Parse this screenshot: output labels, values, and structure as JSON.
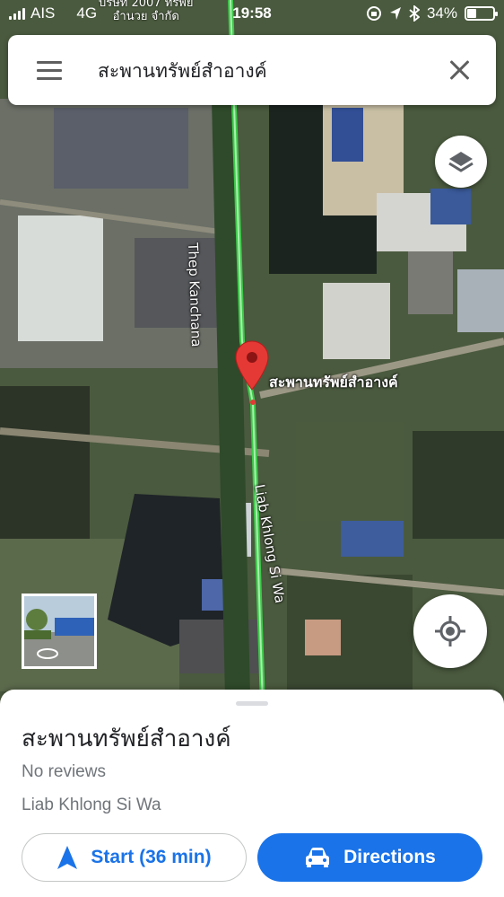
{
  "status_bar": {
    "carrier": "AIS",
    "network": "4G",
    "time": "19:58",
    "battery": "34%",
    "battery_level": 0.34,
    "icons": [
      "signal-icon",
      "rotation-lock-icon",
      "location-arrow-icon",
      "bluetooth-icon",
      "battery-icon"
    ]
  },
  "search": {
    "query": "สะพานทรัพย์สำอางค์",
    "menu_icon": "hamburger-menu-icon",
    "close_icon": "close-icon"
  },
  "map": {
    "road_label_north": "Thep Kanchana",
    "road_label_south": "Liab Khlong Si Wa",
    "pin_label": "สะพานทรัพย์สำอางค์",
    "sign_text_line1": "บริษัท 2007 ทรัพย์",
    "sign_text_line2": "อำนวย จำกัด",
    "pin_color": "#e53935",
    "road_color": "#3ec94a",
    "layers_icon": "layers-icon",
    "location_icon": "my-location-icon"
  },
  "sheet": {
    "title": "สะพานทรัพย์สำอางค์",
    "reviews": "No reviews",
    "address": "Liab Khlong Si Wa",
    "start_label": "Start (36 min)",
    "directions_label": "Directions",
    "accent_color": "#1a73e8"
  }
}
